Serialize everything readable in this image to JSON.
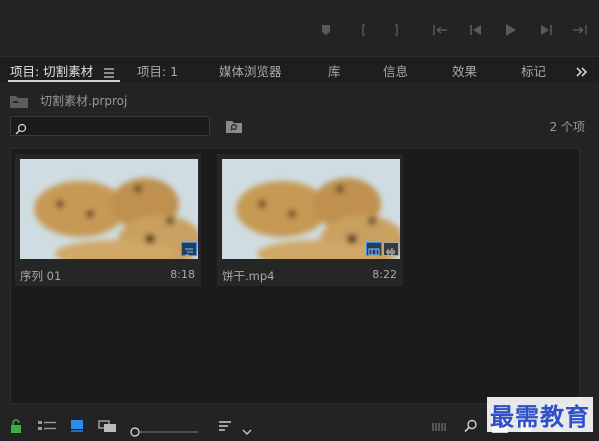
{
  "tabs": [
    {
      "label": "项目: 切割素材"
    },
    {
      "label": "项目: 1"
    },
    {
      "label": "媒体浏览器"
    },
    {
      "label": "库"
    },
    {
      "label": "信息"
    },
    {
      "label": "效果"
    },
    {
      "label": "标记"
    }
  ],
  "project": {
    "path_label": "切割素材.prproj",
    "item_count": "2 个项"
  },
  "search": {
    "placeholder": ""
  },
  "items": [
    {
      "name": "序列 01",
      "duration": "8:18"
    },
    {
      "name": "饼干.mp4",
      "duration": "8:22"
    }
  ],
  "watermark": "最需教育",
  "colors": {
    "accent": "#4a90d9",
    "lock_green": "#3cb043"
  }
}
